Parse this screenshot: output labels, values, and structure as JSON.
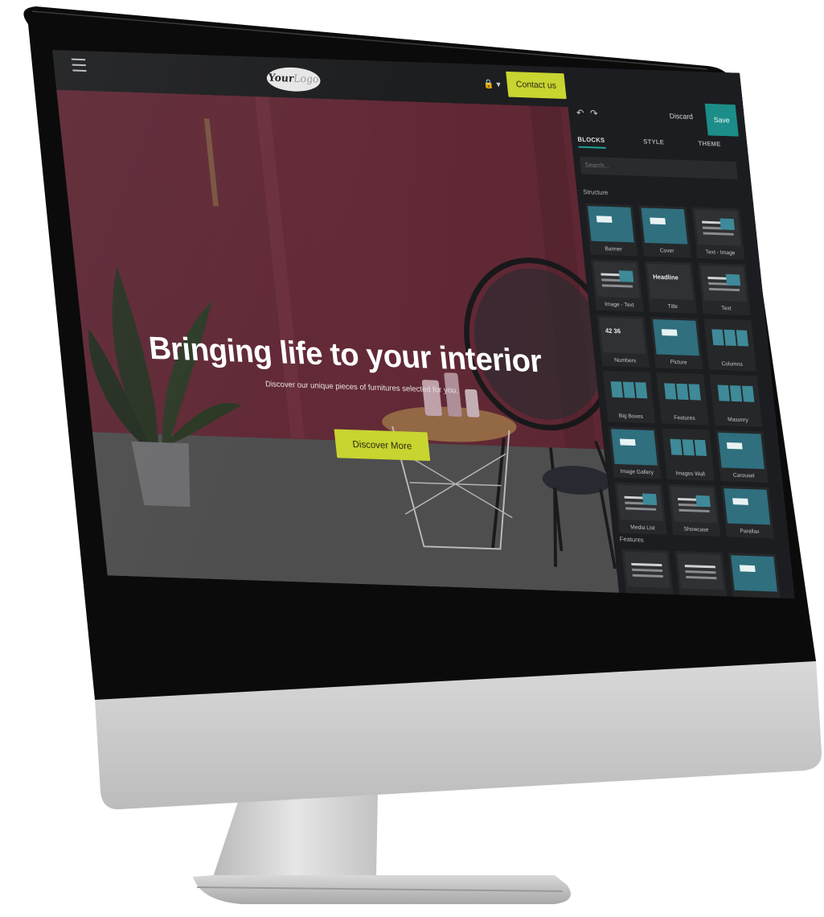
{
  "site": {
    "logo": {
      "main": "Your",
      "soft": "Logo"
    },
    "header_user": "🔒 ▾",
    "contact_label": "Contact us",
    "hero": {
      "title": "Bringing life to your interior",
      "subtitle": "Discover our unique pieces of furnitures selected for you.",
      "cta_label": "Discover More"
    }
  },
  "panel": {
    "undo_icon": "undo-icon",
    "redo_icon": "redo-icon",
    "discard_label": "Discard",
    "save_label": "Save",
    "tabs": [
      {
        "label": "BLOCKS",
        "active": true
      },
      {
        "label": "STYLE",
        "active": false
      },
      {
        "label": "THEME",
        "active": false
      }
    ],
    "search_placeholder": "Search...",
    "sections": {
      "structure": "Structure",
      "features": "Features"
    },
    "blocks": [
      {
        "label": "Banner",
        "kind": "teal"
      },
      {
        "label": "Cover",
        "kind": "teal"
      },
      {
        "label": "Text - Image",
        "kind": "dark"
      },
      {
        "label": "Image - Text",
        "kind": "dark"
      },
      {
        "label": "Title",
        "kind": "dark",
        "big": "Headline"
      },
      {
        "label": "Text",
        "kind": "dark"
      },
      {
        "label": "Numbers",
        "kind": "dark",
        "big": "42  36"
      },
      {
        "label": "Picture",
        "kind": "teal"
      },
      {
        "label": "Columns",
        "kind": "cards"
      },
      {
        "label": "Big Boxes",
        "kind": "cards"
      },
      {
        "label": "Features",
        "kind": "cards"
      },
      {
        "label": "Masonry",
        "kind": "cards"
      },
      {
        "label": "Image Gallery",
        "kind": "teal"
      },
      {
        "label": "Images Wall",
        "kind": "cards"
      },
      {
        "label": "Carousel",
        "kind": "teal"
      },
      {
        "label": "Media List",
        "kind": "dark"
      },
      {
        "label": "Showcase",
        "kind": "dark"
      },
      {
        "label": "Parallax",
        "kind": "teal"
      }
    ]
  },
  "colors": {
    "accent_lime": "#c8d430",
    "accent_teal": "#1c8d88",
    "wall_pink": "#6e2f3e",
    "panel_bg": "#1c1d20"
  }
}
